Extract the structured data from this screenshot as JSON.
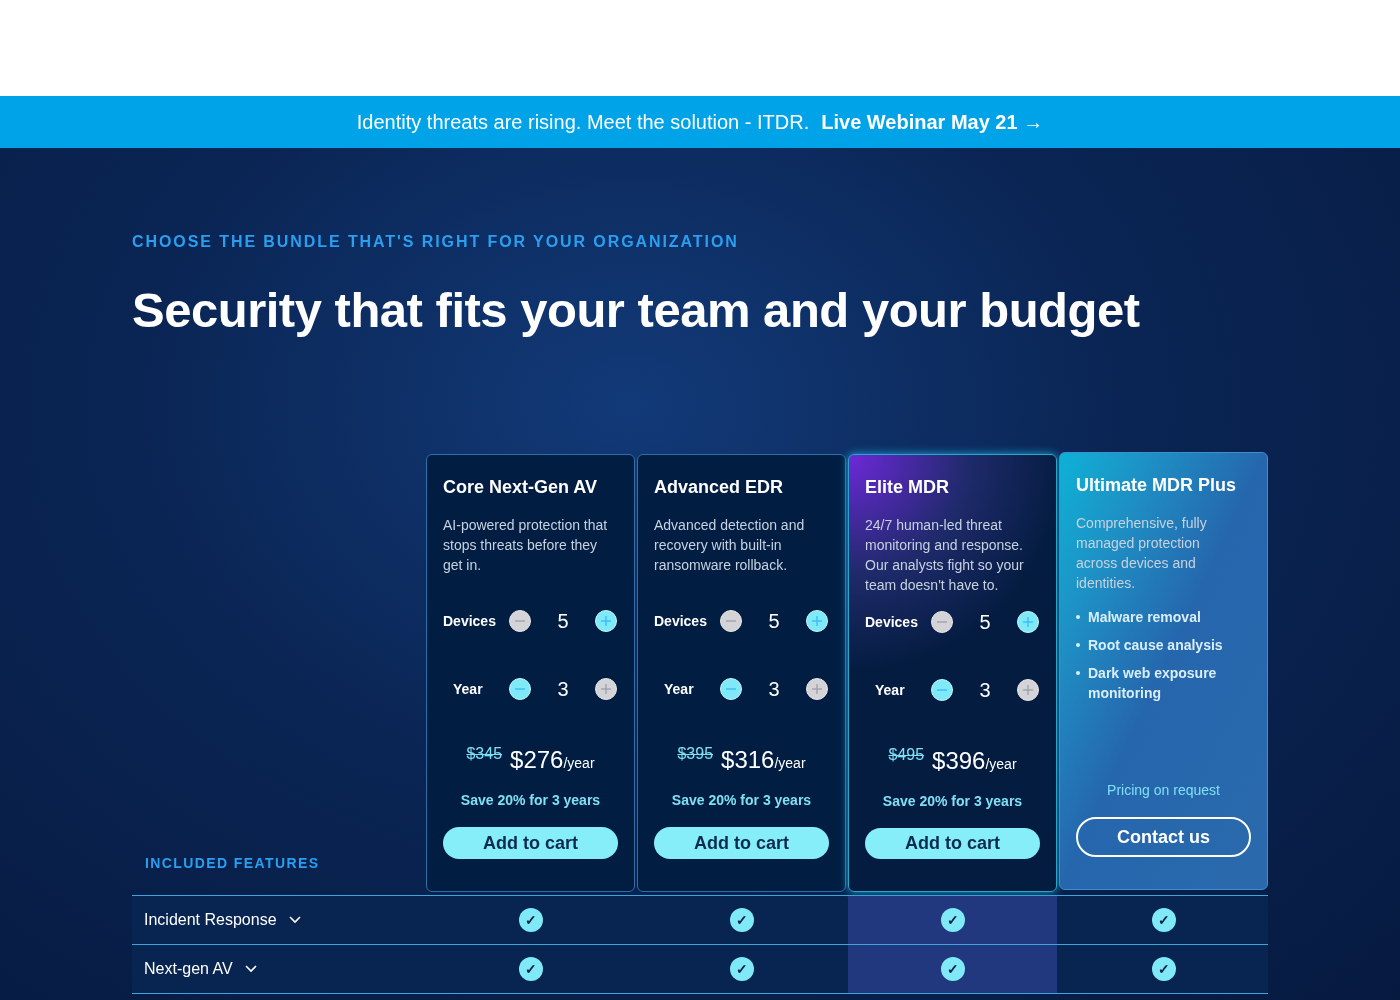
{
  "banner": {
    "text": "Identity threats are rising. Meet the solution - ITDR.",
    "link": "Live Webinar May 21 →"
  },
  "eyebrow": "CHOOSE THE BUNDLE THAT'S RIGHT FOR YOUR ORGANIZATION",
  "heading": "Security that fits your team and your budget",
  "features_label": "INCLUDED FEATURES",
  "plans": [
    {
      "kind": "cart",
      "highlighted": false,
      "name": "Core Next-Gen AV",
      "description": "AI-powered protection that stops threats before they get in.",
      "steppers": [
        {
          "label": "Devices",
          "value": "5",
          "minus_enabled": false,
          "plus_enabled": true
        },
        {
          "label": "Year",
          "value": "3",
          "minus_enabled": true,
          "plus_enabled": false
        }
      ],
      "old_price": "$345",
      "price": "$276",
      "unit": "/year",
      "savings": "Save 20% for 3 years",
      "button": "Add to cart"
    },
    {
      "kind": "cart",
      "highlighted": false,
      "name": "Advanced EDR",
      "description": "Advanced detection and recovery with built-in ransomware rollback.",
      "steppers": [
        {
          "label": "Devices",
          "value": "5",
          "minus_enabled": false,
          "plus_enabled": true
        },
        {
          "label": "Year",
          "value": "3",
          "minus_enabled": true,
          "plus_enabled": false
        }
      ],
      "old_price": "$395",
      "price": "$316",
      "unit": "/year",
      "savings": "Save 20% for 3 years",
      "button": "Add to cart"
    },
    {
      "kind": "cart",
      "highlighted": true,
      "name": "Elite MDR",
      "description": "24/7 human-led threat monitoring and response. Our analysts fight so your team doesn't have to.",
      "steppers": [
        {
          "label": "Devices",
          "value": "5",
          "minus_enabled": false,
          "plus_enabled": true
        },
        {
          "label": "Year",
          "value": "3",
          "minus_enabled": true,
          "plus_enabled": false
        }
      ],
      "old_price": "$495",
      "price": "$396",
      "unit": "/year",
      "savings": "Save 20% for 3 years",
      "button": "Add to cart"
    },
    {
      "kind": "contact",
      "highlighted": false,
      "name": "Ultimate MDR Plus",
      "description": "Comprehensive, fully managed protection across devices and identities.",
      "bullets": [
        "Malware removal",
        "Root cause analysis",
        "Dark web exposure monitoring"
      ],
      "pricing_note": "Pricing on request",
      "button": "Contact us"
    }
  ],
  "features": [
    {
      "name": "Incident Response",
      "checks": [
        "✓",
        "✓",
        "✓",
        "✓"
      ]
    },
    {
      "name": "Next-gen AV",
      "checks": [
        "✓",
        "✓",
        "✓",
        "✓"
      ]
    }
  ]
}
